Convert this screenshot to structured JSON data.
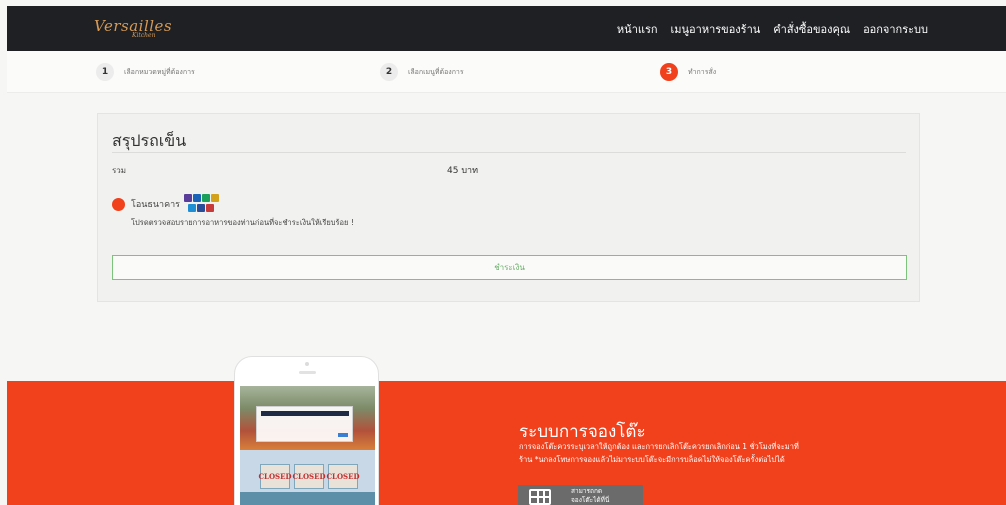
{
  "navbar": {
    "brand": "Versailles",
    "brand_sub": "Kitchen",
    "links": [
      "หน้าแรก",
      "เมนูอาหารของร้าน",
      "คำสั่งซื้อของคุณ",
      "ออกจากระบบ"
    ]
  },
  "steps": [
    {
      "num": "1",
      "label": "เลือกหมวดหมู่ที่ต้องการ",
      "active": false
    },
    {
      "num": "2",
      "label": "เลือกเมนูที่ต้องการ",
      "active": false
    },
    {
      "num": "3",
      "label": "ทำการสั่ง",
      "active": true
    }
  ],
  "summary": {
    "title": "สรุปรถเข็น",
    "total_label": "รวม",
    "total_value": "45 บาท",
    "payment_method": "โอนธนาคาร",
    "note": "โปรดตรวจสอบรายการอาหารของท่านก่อนที่จะชำระเงินให้เรียบร้อย !",
    "pay_button": "ชำระเงิน"
  },
  "banner": {
    "closed_sign": "CLOSED",
    "title": "ระบบการจองโต๊ะ",
    "desc_line1": "การจองโต๊ะควรระบุเวลาให้ถูกต้อง และการยกเลิกโต๊ะควรยกเลิกก่อน 1 ชั่วโมงที่จะมาที่",
    "desc_line2": "ร้าน *นกลงโทษการจองแล้วไม่มาระบบโต๊ะจะมีการบล็อคไม่ให้จองโต๊ะครั้งต่อไปได้",
    "download_line1": "สามารถกด",
    "download_line2": "จองโต๊ะได้ที่นี่"
  },
  "colors": {
    "accent": "#f0401c",
    "navbar": "#1e2024",
    "brand": "#d79a55",
    "pay_border": "#7cc47c"
  }
}
